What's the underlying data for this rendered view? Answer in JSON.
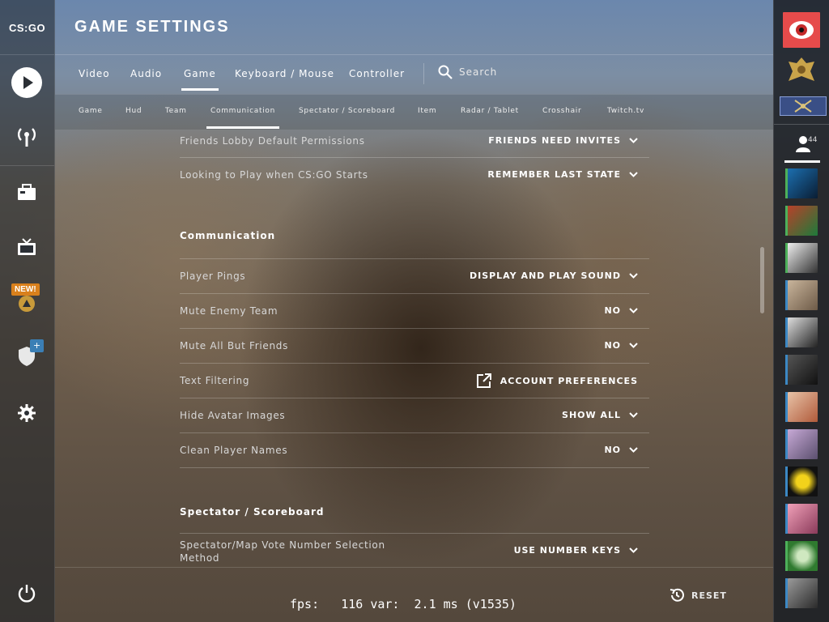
{
  "app": {
    "logo": "CS:GO",
    "title": "GAME SETTINGS"
  },
  "main_tabs": [
    {
      "label": "Video"
    },
    {
      "label": "Audio"
    },
    {
      "label": "Game"
    },
    {
      "label": "Keyboard / Mouse"
    },
    {
      "label": "Controller"
    }
  ],
  "active_main_tab": "Game",
  "search": {
    "label": "Search"
  },
  "sub_tabs": [
    {
      "label": "Game"
    },
    {
      "label": "Hud"
    },
    {
      "label": "Team"
    },
    {
      "label": "Communication"
    },
    {
      "label": "Spectator / Scoreboard"
    },
    {
      "label": "Item"
    },
    {
      "label": "Radar / Tablet"
    },
    {
      "label": "Crosshair"
    },
    {
      "label": "Twitch.tv"
    }
  ],
  "active_sub_tab": "Communication",
  "settings": {
    "pre_rows": [
      {
        "label": "Friends Lobby Default Permissions",
        "value": "FRIENDS NEED INVITES"
      },
      {
        "label": "Looking to Play when CS:GO Starts",
        "value": "REMEMBER LAST STATE"
      }
    ],
    "communication": {
      "heading": "Communication",
      "rows": [
        {
          "label": "Player Pings",
          "value": "DISPLAY AND PLAY SOUND"
        },
        {
          "label": "Mute Enemy Team",
          "value": "NO"
        },
        {
          "label": "Mute All But Friends",
          "value": "NO"
        },
        {
          "label": "Text Filtering",
          "value": "ACCOUNT PREFERENCES"
        },
        {
          "label": "Hide Avatar Images",
          "value": "SHOW ALL"
        },
        {
          "label": "Clean Player Names",
          "value": "NO"
        }
      ]
    },
    "spectator": {
      "heading": "Spectator / Scoreboard",
      "rows": [
        {
          "label": "Spectator/Map Vote Number Selection Method",
          "value": "USE NUMBER KEYS"
        }
      ]
    }
  },
  "nav": {
    "new_badge": "NEW!",
    "plus_badge": "+"
  },
  "footer": {
    "fps_text": "fps:   116 var:  2.1 ms (v1535)",
    "reset_label": "RESET"
  },
  "friends": {
    "count": "44"
  },
  "colors": {
    "accent_orange": "#d9801c",
    "online_green": "#4db05a",
    "accent_blue": "#3b7fb5"
  }
}
